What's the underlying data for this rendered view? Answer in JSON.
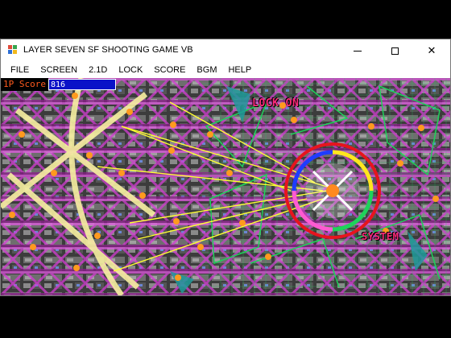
{
  "window": {
    "title": "LAYER SEVEN SF SHOOTING GAME VB",
    "controls": [
      "minimize",
      "maximize",
      "close"
    ],
    "close_glyph": "✕"
  },
  "menu": [
    "FILE",
    "SCREEN",
    "2.1D",
    "LOCK",
    "SCORE",
    "BGM",
    "HELP"
  ],
  "hud": {
    "score_label": "1P Score",
    "score_value": "816",
    "score_box_color": "#0a12c8",
    "label_color": "#ff5a1e"
  },
  "game": {
    "lock_on_text": "LOCK ON",
    "system_text": "SYSTEM",
    "palette": {
      "girder": "#d23cd2",
      "laser": "#f2f25a",
      "wireframe": "#1ed25a",
      "bullet": "#ff9a1e",
      "reticle_ring": "#e6141e"
    }
  }
}
